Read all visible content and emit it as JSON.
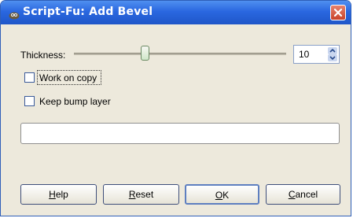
{
  "window": {
    "title": "Script-Fu: Add Bevel",
    "close_icon": "close-icon",
    "app_icon": "gimp-icon"
  },
  "thickness": {
    "label": "Thickness:",
    "value": "10",
    "slider_fraction": 0.34
  },
  "options": {
    "work_on_copy": {
      "label": "Work on copy",
      "checked": false
    },
    "keep_bump_layer": {
      "label": "Keep bump layer",
      "checked": false
    }
  },
  "status_field": {
    "value": ""
  },
  "buttons": {
    "help": {
      "mnemonic": "H",
      "rest": "elp"
    },
    "reset": {
      "mnemonic": "R",
      "rest": "eset"
    },
    "ok": {
      "mnemonic": "O",
      "rest": "K"
    },
    "cancel": {
      "mnemonic": "C",
      "rest": "ancel"
    }
  },
  "colors": {
    "titlebar": "#2a67e0",
    "dialog_bg": "#ede9dc",
    "close": "#c9432a"
  }
}
